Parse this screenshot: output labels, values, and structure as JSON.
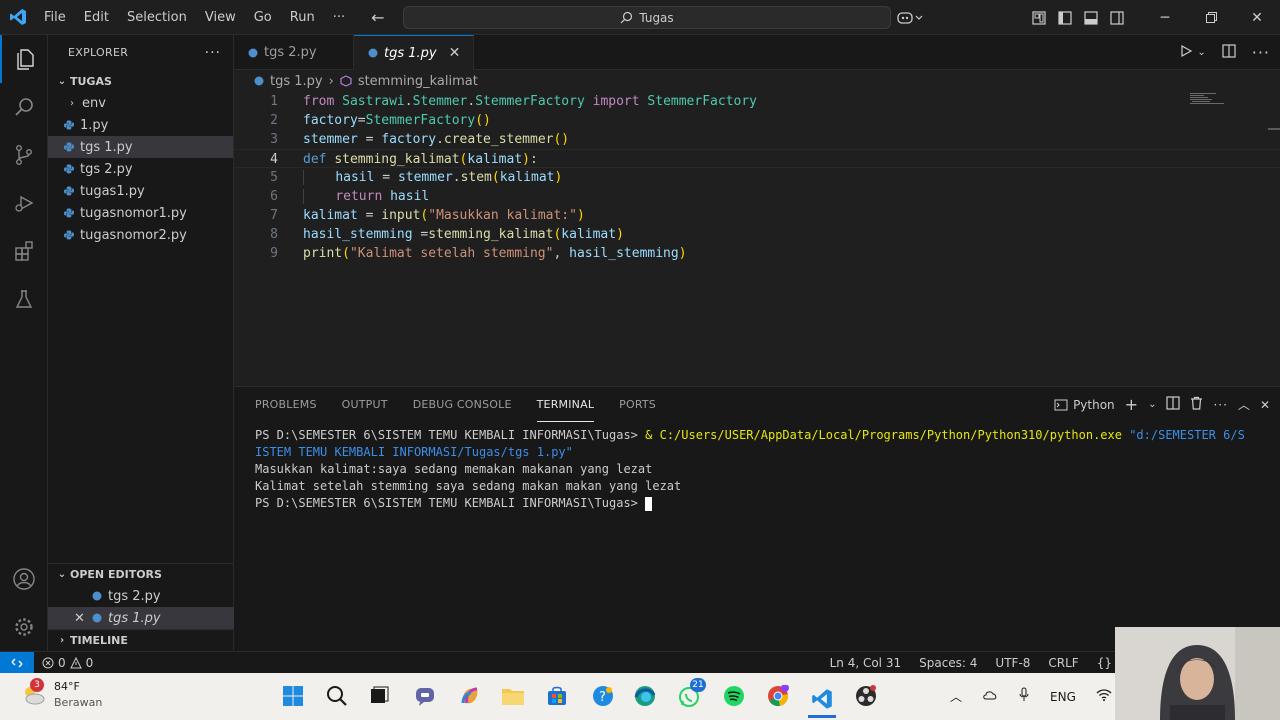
{
  "titlebar": {
    "menu": [
      "File",
      "Edit",
      "Selection",
      "View",
      "Go",
      "Run",
      "···"
    ],
    "search_text": "Tugas"
  },
  "sidebar": {
    "header": "EXPLORER",
    "folder": "TUGAS",
    "items": [
      {
        "label": "env",
        "type": "folder"
      },
      {
        "label": "1.py",
        "type": "file"
      },
      {
        "label": "tgs 1.py",
        "type": "file",
        "selected": true
      },
      {
        "label": "tgs 2.py",
        "type": "file"
      },
      {
        "label": "tugas1.py",
        "type": "file"
      },
      {
        "label": "tugasnomor1.py",
        "type": "file"
      },
      {
        "label": "tugasnomor2.py",
        "type": "file"
      }
    ],
    "open_editors_title": "OPEN EDITORS",
    "open_editors": [
      {
        "label": "tgs 2.py"
      },
      {
        "label": "tgs 1.py",
        "active": true
      }
    ],
    "timeline_title": "TIMELINE"
  },
  "tabs": [
    {
      "label": "tgs 2.py"
    },
    {
      "label": "tgs 1.py",
      "active": true
    }
  ],
  "breadcrumb": {
    "file": "tgs 1.py",
    "symbol": "stemming_kalimat"
  },
  "code": {
    "line_numbers": [
      "1",
      "2",
      "3",
      "4",
      "5",
      "6",
      "7",
      "8",
      "9"
    ],
    "current_line": 4
  },
  "panel": {
    "tabs": [
      "PROBLEMS",
      "OUTPUT",
      "DEBUG CONSOLE",
      "TERMINAL",
      "PORTS"
    ],
    "active_tab": "TERMINAL",
    "shell": "Python",
    "terminal": {
      "l1_prompt": "PS D:\\SEMESTER 6\\SISTEM TEMU KEMBALI INFORMASI\\Tugas> ",
      "l1_amp": "& ",
      "l1_exe": "C:/Users/USER/AppData/Local/Programs/Python/Python310/python.exe",
      "l1_arg": " \"d:/SEMESTER 6/S",
      "l2_arg": "ISTEM TEMU KEMBALI INFORMASI/Tugas/tgs 1.py\"",
      "l3": "Masukkan kalimat:saya sedang memakan makanan yang lezat",
      "l4": "Kalimat setelah stemming saya sedang makan makan yang lezat",
      "l5_prompt": "PS D:\\SEMESTER 6\\SISTEM TEMU KEMBALI INFORMASI\\Tugas> "
    }
  },
  "statusbar": {
    "errors": "0",
    "warnings": "0",
    "position": "Ln 4, Col 31",
    "spaces": "Spaces: 4",
    "encoding": "UTF-8",
    "eol": "CRLF",
    "lang": "{}"
  },
  "taskbar": {
    "weather_temp": "84°F",
    "weather_desc": "Berawan",
    "weather_badge": "3",
    "tray_lang": "ENG",
    "whatsapp_badge": "21"
  },
  "colors": {
    "accent": "#0078d4",
    "keyword": "#c586c0",
    "function": "#dcdcaa",
    "class": "#4ec9b0",
    "string": "#ce9178",
    "variable": "#9cdcfe"
  }
}
